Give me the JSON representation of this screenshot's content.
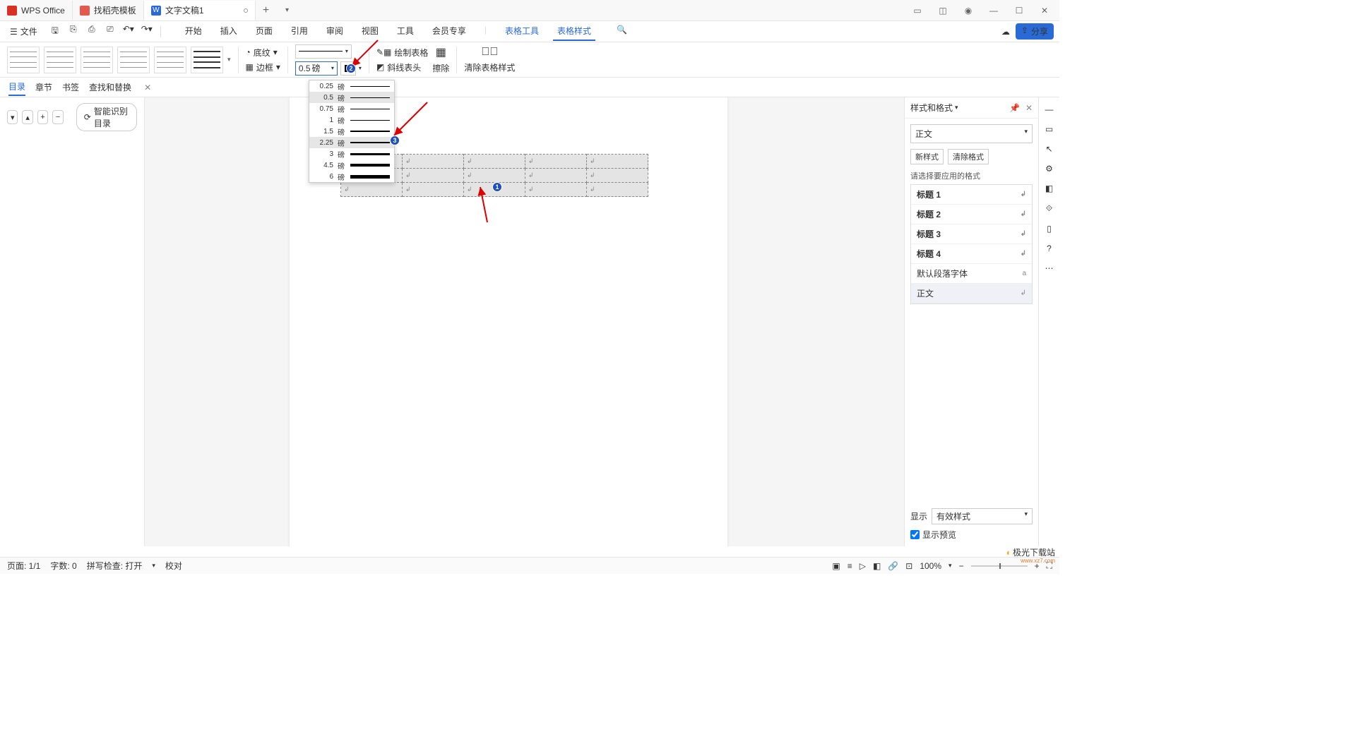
{
  "titlebar": {
    "app": "WPS Office",
    "template_tab": "找稻壳模板",
    "doc_tab": "文字文稿1",
    "doc_badge": "W"
  },
  "menubar": {
    "file": "文件",
    "items": [
      "开始",
      "插入",
      "页面",
      "引用",
      "审阅",
      "视图",
      "工具",
      "会员专享",
      "表格工具",
      "表格样式"
    ],
    "share": "分享"
  },
  "ribbon": {
    "shading": "底纹",
    "shading_dd": "▾",
    "border": "边框",
    "border_dd": "▾",
    "width_value": "0.5",
    "width_unit": "磅",
    "draw_table": "绘制表格",
    "diag_header": "斜线表头",
    "erase": "擦除",
    "clear_style": "清除表格样式"
  },
  "width_dropdown": {
    "unit": "磅",
    "options": [
      "0.25",
      "0.5",
      "0.75",
      "1",
      "1.5",
      "2.25",
      "3",
      "4.5",
      "6"
    ],
    "heights": [
      1,
      1,
      1,
      1,
      2,
      2,
      3,
      4,
      5
    ],
    "hover_index": 1,
    "highlight_index": 5
  },
  "navpane": {
    "tabs": [
      "目录",
      "章节",
      "书签",
      "查找和替换"
    ],
    "smart_toc": "智能识别目录"
  },
  "right_panel": {
    "title": "样式和格式",
    "title_dd": "▾",
    "current": "正文",
    "new_style": "新样式",
    "clear_fmt": "清除格式",
    "choose_label": "请选择要应用的格式",
    "items": [
      "标题 1",
      "标题 2",
      "标题 3",
      "标题 4"
    ],
    "default_font": "默认段落字体",
    "body": "正文",
    "show_label": "显示",
    "show_value": "有效样式",
    "preview_cb": "显示预览"
  },
  "status": {
    "page": "页面: 1/1",
    "words": "字数: 0",
    "spell": "拼写检查: 打开",
    "proof": "校对",
    "zoom": "100%"
  },
  "markers": {
    "m1": "1",
    "m2": "2",
    "m3": "3"
  },
  "watermark": {
    "main": "极光下载站",
    "sub": "www.xz7.com"
  }
}
